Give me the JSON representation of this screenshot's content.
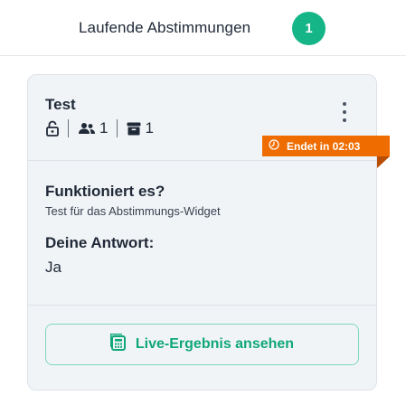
{
  "header": {
    "title": "Laufende Abstimmungen",
    "count": "1",
    "accent_color": "#16b587"
  },
  "poll": {
    "title": "Test",
    "lock_icon": "lock-open-icon",
    "participants_icon": "users-icon",
    "participants_count": "1",
    "archive_icon": "archive-icon",
    "archive_count": "1",
    "menu_icon": "kebab-menu-icon",
    "deadline_icon": "clock-icon",
    "deadline_label": "Endet in 02:03",
    "deadline_color": "#ef6c00",
    "question": "Funktioniert es?",
    "description": "Test für das Abstimmungs-Widget",
    "answer_label": "Deine Antwort:",
    "answer_value": "Ja",
    "results_button_icon": "calculator-icon",
    "results_button_label": "Live-Ergebnis ansehen",
    "button_color": "#10a779"
  }
}
